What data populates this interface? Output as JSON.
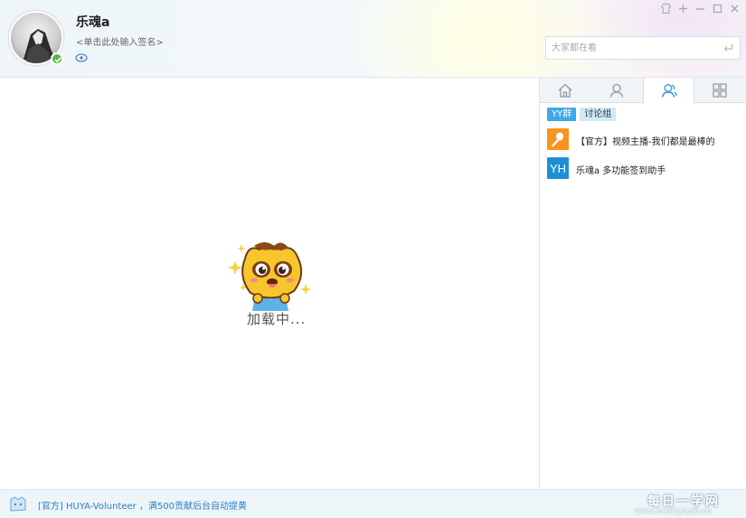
{
  "header": {
    "username": "乐魂a",
    "signature": "<单击此处输入签名>",
    "search_placeholder": "大家都在看"
  },
  "icons": {
    "avatar": "avatar",
    "online_status": "check-icon",
    "visibility": "eye-icon",
    "window_controls": [
      "skin-icon",
      "pin-icon",
      "minimize-icon",
      "maximize-icon",
      "close-icon"
    ],
    "search_submit": "enter-icon",
    "tabs": [
      "home-icon",
      "contact-icon",
      "group-icon",
      "apps-icon"
    ]
  },
  "main": {
    "loading_text": "加载中..."
  },
  "right_panel": {
    "active_tab_index": 2,
    "subtabs": [
      {
        "label": "YY群",
        "active": true
      },
      {
        "label": "讨论组",
        "active": false
      }
    ],
    "groups": [
      {
        "name": "【官方】视频主播-我们都是最棒的",
        "icon": "microphone-icon",
        "icon_color": "#f7941d"
      },
      {
        "name": "乐魂a 多功能签到助手",
        "icon": "yh-logo-icon",
        "icon_color": "#1e8fd6",
        "icon_text": "YH"
      }
    ]
  },
  "bottom_bar": {
    "notice": "[官方] HUYA-Volunteer ，满500贡献后台自动提黄"
  },
  "watermark": {
    "title": "每日一学网",
    "url": "www.meiriyixue.cn"
  },
  "colors": {
    "accent": "#3fa9e5",
    "status_online": "#52b84a",
    "link": "#2a7fc4"
  }
}
